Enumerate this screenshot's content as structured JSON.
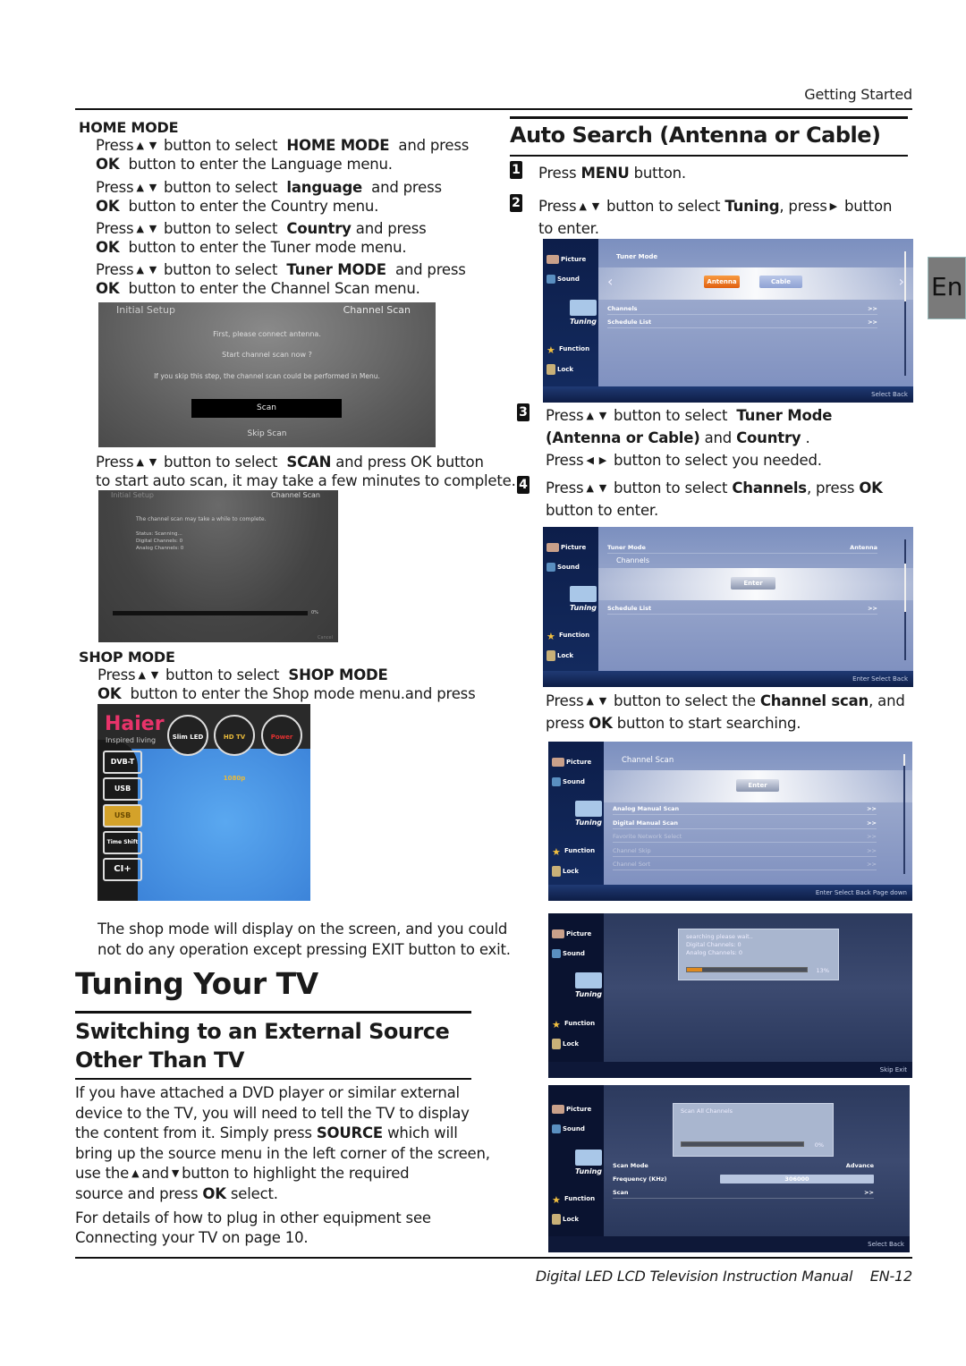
{
  "header": {
    "section": "Getting Started"
  },
  "lang_tab": "En",
  "footer": {
    "title": "Digital LED LCD Television Instruction Manual",
    "page": "EN-12"
  },
  "arrows": {
    "up": "▲",
    "down": "▼",
    "left": "◀",
    "right": "▶"
  },
  "home_mode": {
    "heading": "HOME MODE",
    "steps": [
      {
        "pre": "Press",
        "mid": "button to select",
        "bold": "HOME MODE",
        "post": "and press",
        "l2b": "OK",
        "l2": "button to enter the Language menu."
      },
      {
        "pre": "Press",
        "mid": "button to select",
        "bold": "language",
        "post": "and press",
        "l2b": "OK",
        "l2": "button to enter the Country menu."
      },
      {
        "pre": "Press",
        "mid": "button to select",
        "bold": "Country",
        "post": "and press",
        "l2b": "OK",
        "l2": "button to enter the Tuner mode menu."
      },
      {
        "pre": "Press",
        "mid": "button to select",
        "bold": "Tuner MODE",
        "post": "and press",
        "l2b": "OK",
        "l2": "button to enter the Channel Scan menu."
      }
    ],
    "screen1": {
      "title_left": "Initial Setup",
      "title_right": "Channel Scan",
      "line1": "First, please connect antenna.",
      "line2": "Start channel scan now ?",
      "line3": "If you skip this step, the channel scan could be performed in Menu.",
      "scan_button": "Scan",
      "skip_button": "Skip Scan"
    },
    "scan_note": {
      "pre": "Press",
      "mid": "button to select",
      "bold": "SCAN",
      "post": "and press OK button",
      "l2": "to start auto scan, it may take a few minutes to complete."
    },
    "screen2": {
      "title_left": "Initial Setup",
      "title_right": "Channel Scan",
      "line1": "The channel scan may take a while to complete.",
      "status": "Status: Scanning...",
      "digital": "Digital Channels: 0",
      "analog": "Analog Channels: 0",
      "progress_label": "0%",
      "progress": 0,
      "cancel": "Cancel"
    }
  },
  "shop_mode": {
    "heading": "SHOP MODE",
    "pre": "Press",
    "mid": "button to select",
    "bold": "SHOP MODE",
    "l2b": "OK",
    "l2": "button to enter the Shop mode menu.and press",
    "screen": {
      "brand": "Haier",
      "tagline": "Inspired living",
      "badges": [
        "Slim LED",
        "HD TV 1080p",
        "Power"
      ],
      "side_icons": [
        "DVB-T",
        "USB",
        "USB",
        "Time Shift",
        "CI+"
      ]
    },
    "note1": "The shop mode will display on the screen, and you could",
    "note2": "not do any operation except pressing EXIT button to exit."
  },
  "tuning": {
    "title": "Tuning Your TV",
    "sub1": "Switching to an External Source",
    "sub2": "Other Than TV",
    "para": [
      "If you have attached a DVD player or similar external",
      "device to the TV, you will need to tell the TV to display",
      "the content from it. Simply press",
      "SOURCE",
      "which will",
      "bring up the source menu in the left corner of the screen,",
      "use the",
      "and",
      "button to highlight the required",
      "source and press",
      "OK",
      "select."
    ],
    "para2": [
      "For details of how to plug in other equipment see",
      "Connecting your TV on page 10."
    ]
  },
  "auto_search": {
    "title": "Auto Search (Antenna or Cable)",
    "steps": [
      {
        "no": "1",
        "text1": "Press",
        "b1": "MENU",
        "text2": "button."
      },
      {
        "no": "2",
        "pre": "Press",
        "mid": "button to select",
        "bold": "Tuning",
        "post": ", press",
        "post2": "button",
        "l2": "to enter."
      },
      {
        "no": "3",
        "pre": "Press",
        "mid": "button to select",
        "bold": "Tuner Mode",
        "l2b": "(Antenna or Cable)",
        "l2": "and",
        "l2b2": "Country",
        "l2e": ".",
        "l3a": "Press",
        "l3": "button to select you needed."
      },
      {
        "no": "4",
        "pre": "Press",
        "mid": "button to select",
        "bold": "Channels",
        "post": ", press",
        "bold2": "OK",
        "l2": "button to enter."
      }
    ],
    "scan_note": {
      "pre": "Press",
      "mid": "button to select the",
      "bold": "Channel scan",
      "post": ", and",
      "l2a": "press",
      "l2b": "OK",
      "l2": "button to start searching."
    },
    "menu_side": [
      "Picture",
      "Sound",
      "Tuning",
      "Function",
      "Lock"
    ],
    "screen_a": {
      "title": "Tuner Mode",
      "opt1": "Antenna",
      "opt2": "Cable",
      "rows": [
        {
          "label": "Channels",
          "value": ">>"
        },
        {
          "label": "Schedule List",
          "value": ">>"
        }
      ],
      "footer": "Select   Back"
    },
    "screen_b": {
      "row1": "Tuner Mode",
      "row1v": "Antenna",
      "row2": "Channels",
      "enter": "Enter",
      "row3": "Schedule List",
      "row3v": ">>",
      "footer": "Enter   Select   Back"
    },
    "screen_c": {
      "title": "Channel Scan",
      "enter": "Enter",
      "rows": [
        {
          "label": "Analog Manual Scan",
          "value": ">>"
        },
        {
          "label": "Digital Manual Scan",
          "value": ">>"
        },
        {
          "label": "Favorite Network Select",
          "value": ">>"
        },
        {
          "label": "Channel Skip",
          "value": ">>"
        },
        {
          "label": "Channel Sort",
          "value": ">>"
        }
      ],
      "footer": "Enter   Select   Back   Page down"
    },
    "screen_d": {
      "line1": "searching please wait..",
      "line2": "Digital Channels: 0",
      "line3": "Analog Channels: 0",
      "progress": 13,
      "progress_label": "13%",
      "footer": "Skip   Exit"
    },
    "screen_e": {
      "dialog": "Scan All Channels",
      "progress": 0,
      "progress_label": "0%",
      "row1": "Scan Mode",
      "row1v": "Advance",
      "row2": "Frequency (KHz)",
      "row2v": "306000",
      "row3": "Scan",
      "row3v": ">>",
      "footer": "Select   Back"
    }
  }
}
